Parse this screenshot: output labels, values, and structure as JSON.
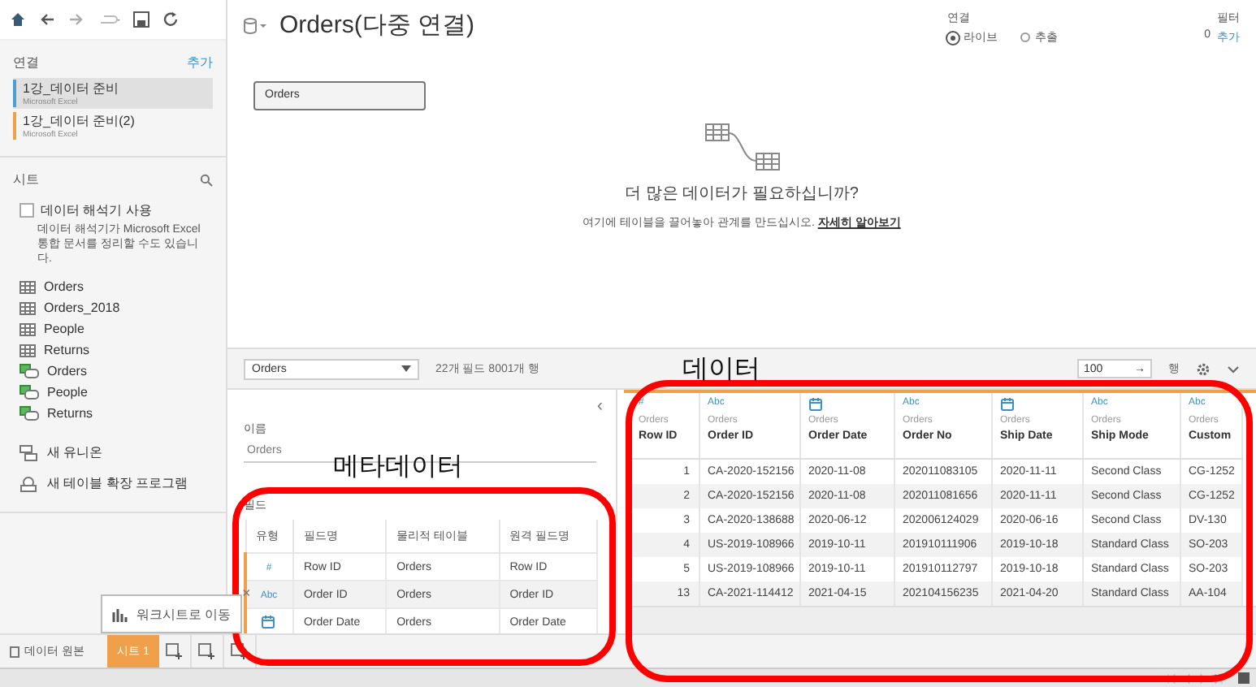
{
  "sidebar": {
    "connections_title": "연결",
    "add_link": "추가",
    "connections": [
      {
        "name": "1강_데이터 준비",
        "type": "Microsoft Excel",
        "selected": true,
        "color": "#4e9ed4"
      },
      {
        "name": "1강_데이터 준비(2)",
        "type": "Microsoft Excel",
        "selected": false,
        "color": "#f0a04b"
      }
    ],
    "sheets_title": "시트",
    "interpreter": {
      "label": "데이터 해석기 사용",
      "checked": false,
      "description": "데이터 해석기가 Microsoft Excel 통합 문서를 정리할 수도 있습니다."
    },
    "sheets": [
      {
        "name": "Orders",
        "kind": "sheet"
      },
      {
        "name": "Orders_2018",
        "kind": "sheet"
      },
      {
        "name": "People",
        "kind": "sheet"
      },
      {
        "name": "Returns",
        "kind": "sheet"
      },
      {
        "name": "Orders",
        "kind": "named-range"
      },
      {
        "name": "People",
        "kind": "named-range"
      },
      {
        "name": "Returns",
        "kind": "named-range"
      }
    ],
    "actions": [
      {
        "label": "새 유니온",
        "kind": "union"
      },
      {
        "label": "새 테이블 확장 프로그램",
        "kind": "extension"
      }
    ]
  },
  "canvas": {
    "title": "Orders(다중 연결)",
    "connection": {
      "label": "연결",
      "options": [
        {
          "label": "라이브",
          "selected": true
        },
        {
          "label": "추출",
          "selected": false
        }
      ]
    },
    "filters": {
      "label": "필터",
      "count": "0",
      "add_link": "추가"
    },
    "tables": [
      {
        "name": "Orders"
      }
    ],
    "hint": {
      "heading": "더 많은 데이터가 필요하십니까?",
      "text": "여기에 테이블을 끌어놓아 관계를 만드십시오.",
      "link": "자세히 알아보기"
    }
  },
  "grid_toolbar": {
    "table_select": "Orders",
    "summary": "22개 필드 8001개 행",
    "rows_input": "100",
    "rows_go": "→",
    "rows_unit": "행"
  },
  "annotations": [
    {
      "text": "데이터",
      "kind": "data"
    },
    {
      "text": "메타데이터",
      "kind": "metadata"
    }
  ],
  "metadata": {
    "collapse": "‹",
    "name_label": "이름",
    "name_value": "Orders",
    "fields_label": "필드",
    "columns": [
      "유형",
      "필드명",
      "물리적 테이블",
      "원격 필드명"
    ],
    "rows": [
      {
        "kind": "number",
        "type_label": "#",
        "field": "Row ID",
        "table": "Orders",
        "remote": "Row ID"
      },
      {
        "kind": "string",
        "type_label": "Abc",
        "field": "Order ID",
        "table": "Orders",
        "remote": "Order ID"
      },
      {
        "kind": "date",
        "field": "Order Date",
        "table": "Orders",
        "remote": "Order Date"
      }
    ]
  },
  "data_grid": {
    "columns": [
      {
        "kind": "number",
        "type_label": "#",
        "table": "Orders",
        "name": "Row ID"
      },
      {
        "kind": "string",
        "type_label": "Abc",
        "table": "Orders",
        "name": "Order ID"
      },
      {
        "kind": "date",
        "table": "Orders",
        "name": "Order Date"
      },
      {
        "kind": "string",
        "type_label": "Abc",
        "table": "Orders",
        "name": "Order No"
      },
      {
        "kind": "date",
        "table": "Orders",
        "name": "Ship Date"
      },
      {
        "kind": "string",
        "type_label": "Abc",
        "table": "Orders",
        "name": "Ship Mode"
      },
      {
        "kind": "string",
        "type_label": "Abc",
        "table": "Orders",
        "name": "Custom"
      }
    ],
    "rows": [
      [
        "1",
        "CA-2020-152156",
        "2020-11-08",
        "202011083105",
        "2020-11-11",
        "Second Class",
        "CG-1252"
      ],
      [
        "2",
        "CA-2020-152156",
        "2020-11-08",
        "202011081656",
        "2020-11-11",
        "Second Class",
        "CG-1252"
      ],
      [
        "3",
        "CA-2020-138688",
        "2020-06-12",
        "202006124029",
        "2020-06-16",
        "Second Class",
        "DV-130"
      ],
      [
        "4",
        "US-2019-108966",
        "2019-10-11",
        "201910111906",
        "2019-10-18",
        "Standard Class",
        "SO-203"
      ],
      [
        "5",
        "US-2019-108966",
        "2019-10-11",
        "201910112797",
        "2019-10-18",
        "Standard Class",
        "SO-203"
      ],
      [
        "13",
        "CA-2021-114412",
        "2021-04-15",
        "202104156235",
        "2021-04-20",
        "Standard Class",
        "AA-104"
      ]
    ]
  },
  "bottom_bar": {
    "tabs": [
      {
        "label": "데이터 원본",
        "kind": "source",
        "selected": false
      },
      {
        "label": "시트 1",
        "kind": "sheet",
        "selected": true
      }
    ],
    "tooltip": {
      "text": "워크시트로 이동",
      "close": "×"
    }
  }
}
